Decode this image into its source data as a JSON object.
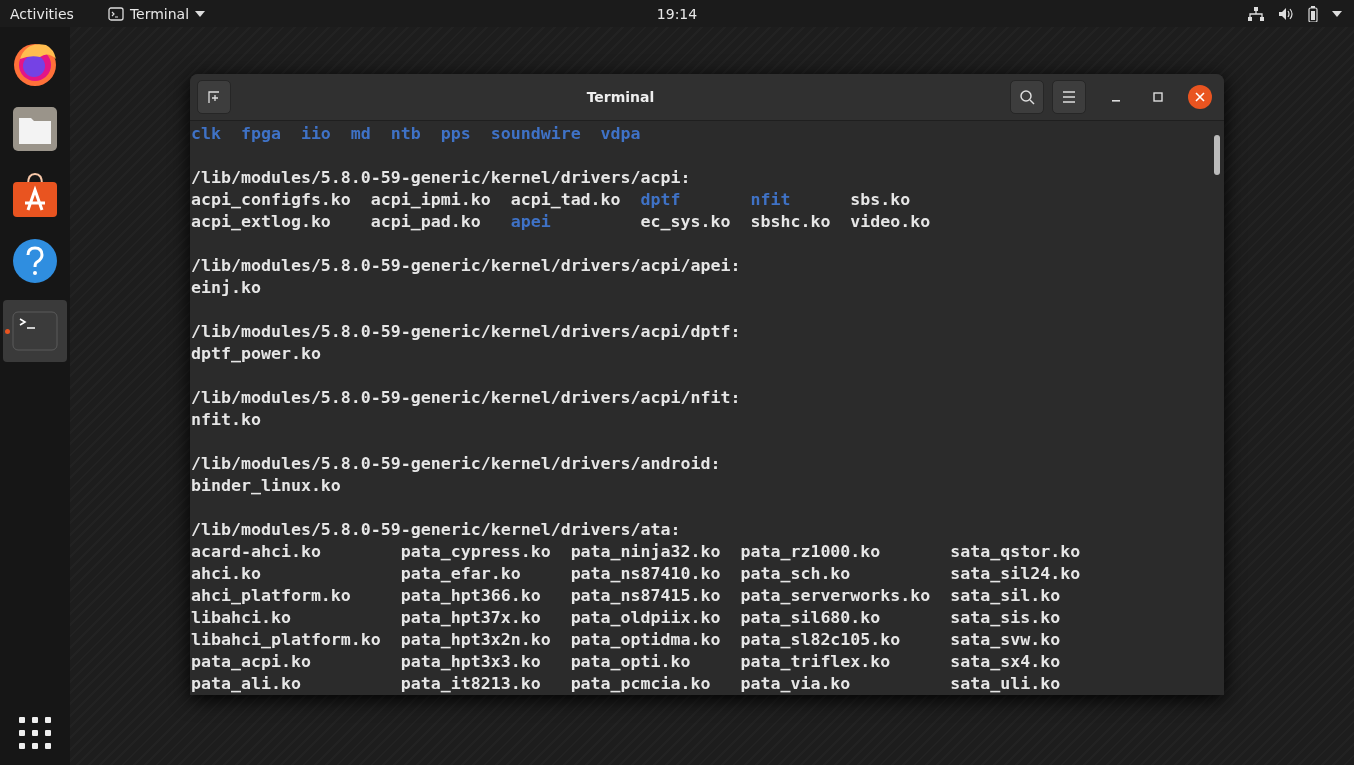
{
  "top_bar": {
    "activities": "Activities",
    "app_menu": "Terminal",
    "clock": "19:14"
  },
  "dock": {
    "items": [
      {
        "kind": "browser",
        "selected": false
      },
      {
        "kind": "files",
        "selected": false
      },
      {
        "kind": "software",
        "selected": false
      },
      {
        "kind": "help",
        "selected": false
      },
      {
        "kind": "terminal",
        "selected": true
      }
    ]
  },
  "window": {
    "title": "Terminal"
  },
  "terminal": {
    "blocks": [
      {
        "rows": [
          [
            {
              "text": "clk",
              "kind": "dir"
            },
            {
              "text": "fpga",
              "kind": "dir"
            },
            {
              "text": "iio",
              "kind": "dir"
            },
            {
              "text": "md",
              "kind": "dir"
            },
            {
              "text": "ntb",
              "kind": "dir"
            },
            {
              "text": "pps",
              "kind": "dir"
            },
            {
              "text": "soundwire",
              "kind": "dir"
            },
            {
              "text": "vdpa",
              "kind": "dir"
            }
          ]
        ]
      },
      {
        "path": "/lib/modules/5.8.0-59-generic/kernel/drivers/acpi:",
        "rows": [
          [
            {
              "text": "acpi_configfs.ko",
              "kind": "file"
            },
            {
              "text": "acpi_ipmi.ko",
              "kind": "file"
            },
            {
              "text": "acpi_tad.ko",
              "kind": "file"
            },
            {
              "text": "dptf",
              "kind": "dir"
            },
            {
              "text": "nfit",
              "kind": "dir"
            },
            {
              "text": "sbs.ko",
              "kind": "file"
            }
          ],
          [
            {
              "text": "acpi_extlog.ko",
              "kind": "file"
            },
            {
              "text": "acpi_pad.ko",
              "kind": "file"
            },
            {
              "text": "apei",
              "kind": "dir"
            },
            {
              "text": "ec_sys.ko",
              "kind": "file"
            },
            {
              "text": "sbshc.ko",
              "kind": "file"
            },
            {
              "text": "video.ko",
              "kind": "file"
            }
          ]
        ]
      },
      {
        "path": "/lib/modules/5.8.0-59-generic/kernel/drivers/acpi/apei:",
        "rows": [
          [
            {
              "text": "einj.ko",
              "kind": "file"
            }
          ]
        ]
      },
      {
        "path": "/lib/modules/5.8.0-59-generic/kernel/drivers/acpi/dptf:",
        "rows": [
          [
            {
              "text": "dptf_power.ko",
              "kind": "file"
            }
          ]
        ]
      },
      {
        "path": "/lib/modules/5.8.0-59-generic/kernel/drivers/acpi/nfit:",
        "rows": [
          [
            {
              "text": "nfit.ko",
              "kind": "file"
            }
          ]
        ]
      },
      {
        "path": "/lib/modules/5.8.0-59-generic/kernel/drivers/android:",
        "rows": [
          [
            {
              "text": "binder_linux.ko",
              "kind": "file"
            }
          ]
        ]
      },
      {
        "path": "/lib/modules/5.8.0-59-generic/kernel/drivers/ata:",
        "rows": [
          [
            {
              "text": "acard-ahci.ko",
              "kind": "file"
            },
            {
              "text": "pata_cypress.ko",
              "kind": "file"
            },
            {
              "text": "pata_ninja32.ko",
              "kind": "file"
            },
            {
              "text": "pata_rz1000.ko",
              "kind": "file"
            },
            {
              "text": "sata_qstor.ko",
              "kind": "file"
            }
          ],
          [
            {
              "text": "ahci.ko",
              "kind": "file"
            },
            {
              "text": "pata_efar.ko",
              "kind": "file"
            },
            {
              "text": "pata_ns87410.ko",
              "kind": "file"
            },
            {
              "text": "pata_sch.ko",
              "kind": "file"
            },
            {
              "text": "sata_sil24.ko",
              "kind": "file"
            }
          ],
          [
            {
              "text": "ahci_platform.ko",
              "kind": "file"
            },
            {
              "text": "pata_hpt366.ko",
              "kind": "file"
            },
            {
              "text": "pata_ns87415.ko",
              "kind": "file"
            },
            {
              "text": "pata_serverworks.ko",
              "kind": "file"
            },
            {
              "text": "sata_sil.ko",
              "kind": "file"
            }
          ],
          [
            {
              "text": "libahci.ko",
              "kind": "file"
            },
            {
              "text": "pata_hpt37x.ko",
              "kind": "file"
            },
            {
              "text": "pata_oldpiix.ko",
              "kind": "file"
            },
            {
              "text": "pata_sil680.ko",
              "kind": "file"
            },
            {
              "text": "sata_sis.ko",
              "kind": "file"
            }
          ],
          [
            {
              "text": "libahci_platform.ko",
              "kind": "file"
            },
            {
              "text": "pata_hpt3x2n.ko",
              "kind": "file"
            },
            {
              "text": "pata_optidma.ko",
              "kind": "file"
            },
            {
              "text": "pata_sl82c105.ko",
              "kind": "file"
            },
            {
              "text": "sata_svw.ko",
              "kind": "file"
            }
          ],
          [
            {
              "text": "pata_acpi.ko",
              "kind": "file"
            },
            {
              "text": "pata_hpt3x3.ko",
              "kind": "file"
            },
            {
              "text": "pata_opti.ko",
              "kind": "file"
            },
            {
              "text": "pata_triflex.ko",
              "kind": "file"
            },
            {
              "text": "sata_sx4.ko",
              "kind": "file"
            }
          ],
          [
            {
              "text": "pata_ali.ko",
              "kind": "file"
            },
            {
              "text": "pata_it8213.ko",
              "kind": "file"
            },
            {
              "text": "pata_pcmcia.ko",
              "kind": "file"
            },
            {
              "text": "pata_via.ko",
              "kind": "file"
            },
            {
              "text": "sata_uli.ko",
              "kind": "file"
            }
          ]
        ]
      }
    ]
  }
}
